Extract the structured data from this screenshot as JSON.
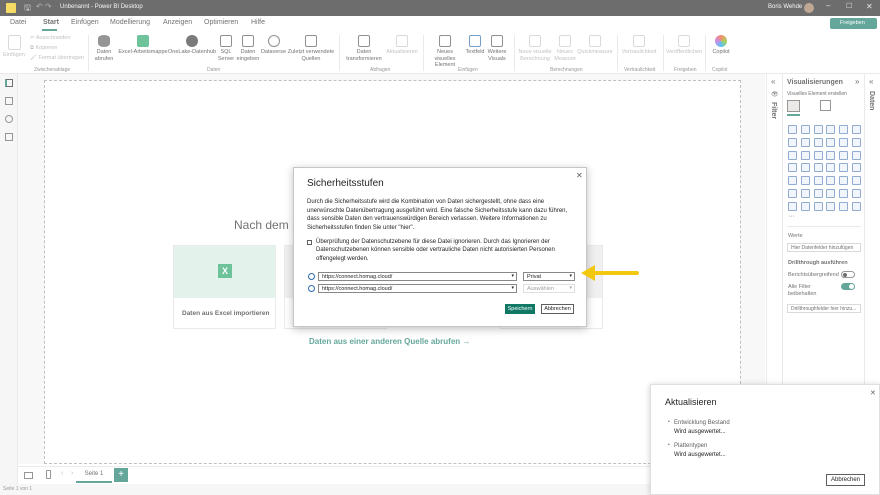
{
  "titlebar": {
    "title": "Unbenannt - Power BI Desktop",
    "user": "Boris Wehde"
  },
  "menu": {
    "items": [
      "Datei",
      "Start",
      "Einfügen",
      "Modellierung",
      "Anzeigen",
      "Optimieren",
      "Hilfe"
    ],
    "share_label": "Freigeben"
  },
  "ribbon": {
    "clipboard": {
      "paste": "Einfügen",
      "cut": "Ausschneiden",
      "copy": "Kopieren",
      "format": "Format übertragen",
      "group": "Zwischenablage"
    },
    "data": {
      "get_data": "Daten abrufen",
      "excel": "Excel-Arbeitsmappe",
      "onelake": "OneLake-Datenhub",
      "sql": "SQL Server",
      "enter": "Daten eingeben",
      "dataverse": "Dataverse",
      "recent": "Zuletzt verwendete Quellen",
      "group": "Daten"
    },
    "queries": {
      "transform": "Daten transformieren",
      "refresh": "Aktualisieren",
      "group": "Abfragen"
    },
    "insert": {
      "new_visual": "Neues visuelles Element",
      "textbox": "Textfeld",
      "more": "Weitere Visuals",
      "group": "Einfügen"
    },
    "calc": {
      "new_calc": "Neue visuelle Berechnung",
      "new_measure": "Neues Measure",
      "quick": "Quickmeasure",
      "group": "Berechnungen"
    },
    "sensitivity": {
      "label": "Vertraulichkeit",
      "group": "Vertraulichkeit"
    },
    "share": {
      "publish": "Veröffentlichen",
      "group": "Freigeben"
    },
    "copilot": {
      "label": "Copilot",
      "group": "Copilot"
    }
  },
  "canvas": {
    "heading_partial": "Nach dem La",
    "excel_card": "Daten aus Excel importieren",
    "other_source_link": "Daten aus einer anderen Quelle abrufen →"
  },
  "pages": {
    "tab": "Seite 1",
    "status": "Seite 1 von 1"
  },
  "panes": {
    "filter": "Filter",
    "data": "Daten",
    "visualizations": {
      "title": "Visualisierungen",
      "build": "Visuelles Element erstellen",
      "values": "Werte",
      "add_fields": "Hier Datenfelder hinzufügen",
      "drillthrough": "Drillthrough ausführen",
      "cross_report": "Berichtsübergreifend",
      "cross_report_state": "Aus",
      "keep_filters": "Alle Filter beibehalten",
      "keep_filters_state": "Ein",
      "drill_fields": "Drillthroughfelder hier hinzu..."
    }
  },
  "dialog": {
    "title": "Sicherheitsstufen",
    "description": "Durch die Sicherheitsstufe wird die Kombination von Daten sichergestellt, ohne dass eine unerwünschte Datenübertragung ausgeführt wird. Eine falsche Sicherheitsstufe kann dazu führen, dass sensible Daten den vertrauenswürdigen Bereich verlassen. Weitere Informationen zu Sicherheitsstufen finden Sie unter \"hier\".",
    "ignore_checkbox": "Überprüfung der Datenschutzebene für diese Datei ignorieren. Durch das Ignorieren der Datenschutzebenen können sensible oder vertrauliche Daten nicht autorisierten Personen offengelegt werden.",
    "rows": [
      {
        "url": "https://connect.homag.cloud/",
        "level": "Privat"
      },
      {
        "url": "https://connect.homag.cloud/",
        "level": "Auswählen"
      }
    ],
    "save": "Speichern",
    "cancel": "Abbrechen"
  },
  "notification": {
    "title": "Aktualisieren",
    "items": [
      {
        "name": "Entwicklung Bestand",
        "status": "Wird ausgewertet..."
      },
      {
        "name": "Plattentypen",
        "status": "Wird ausgewertet..."
      }
    ],
    "cancel": "Abbrechen"
  },
  "colors": {
    "accent": "#117865",
    "highlight_arrow": "#f2c811",
    "excel_green": "#21a366",
    "link": "#117865"
  }
}
